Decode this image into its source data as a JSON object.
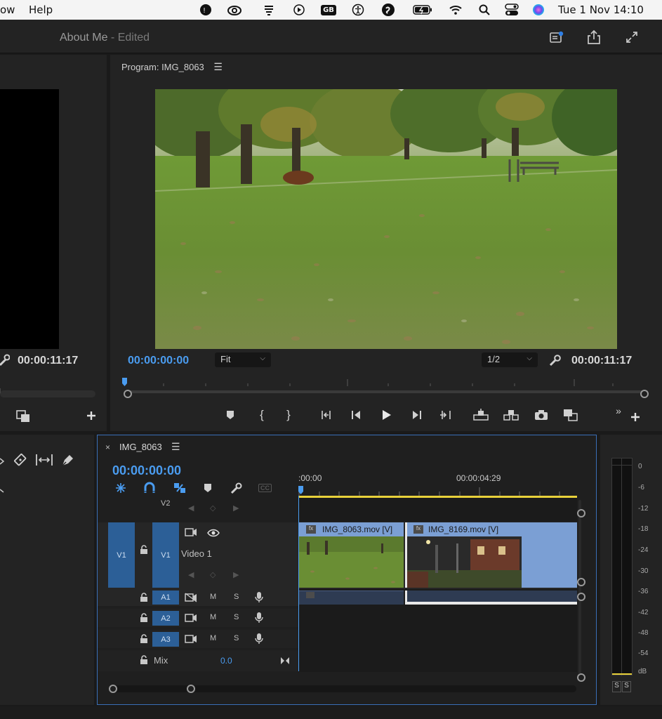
{
  "menubar": {
    "menus": [
      "ow",
      "Help"
    ],
    "status_icons": [
      "bandwidth-icon",
      "creative-cloud-icon",
      "hand-icon",
      "play-icon",
      "gb-icon",
      "accessibility-icon",
      "shazam-icon",
      "battery-icon",
      "wifi-icon",
      "spotlight-icon",
      "control-center-icon",
      "siri-icon"
    ],
    "gb_text": "GB",
    "clock": "Tue 1 Nov  14:10"
  },
  "titlebar": {
    "project_name": "About Me",
    "separator": " - ",
    "state": "Edited"
  },
  "source": {
    "timecode_end": "00:00:11:17"
  },
  "program": {
    "label": "Program: IMG_8063",
    "timecode_current": "00:00:00:00",
    "fit_value": "Fit",
    "resolution_value": "1/2",
    "timecode_end": "00:00:11:17"
  },
  "timeline": {
    "tab_label": "IMG_8063",
    "timecode": "00:00:00:00",
    "ruler_start": ":00:00",
    "ruler_mid": "00:00:04:29",
    "tracks": {
      "v2": "V2",
      "v1_source": "V1",
      "v1": "V1",
      "v1_name": "Video 1",
      "a1": "A1",
      "a2": "A2",
      "a3": "A3",
      "mute": "M",
      "solo": "S",
      "mix_label": "Mix",
      "mix_value": "0.0"
    },
    "clips": [
      {
        "name": "IMG_8063.mov [V]",
        "fx": "fx"
      },
      {
        "name": "IMG_8169.mov [V]",
        "fx": "fx"
      }
    ],
    "cc_label": "CC"
  },
  "meter": {
    "scale": [
      "0",
      "-6",
      "-12",
      "-18",
      "-24",
      "-30",
      "-36",
      "-42",
      "-48",
      "-54",
      "dB"
    ],
    "solo_left": "S",
    "solo_right": "S"
  },
  "colors": {
    "accent_blue": "#4a9cf0",
    "track_blue": "#2c5f97",
    "work_area_yellow": "#e8d13a",
    "clip_blue": "#7b9fd4"
  }
}
